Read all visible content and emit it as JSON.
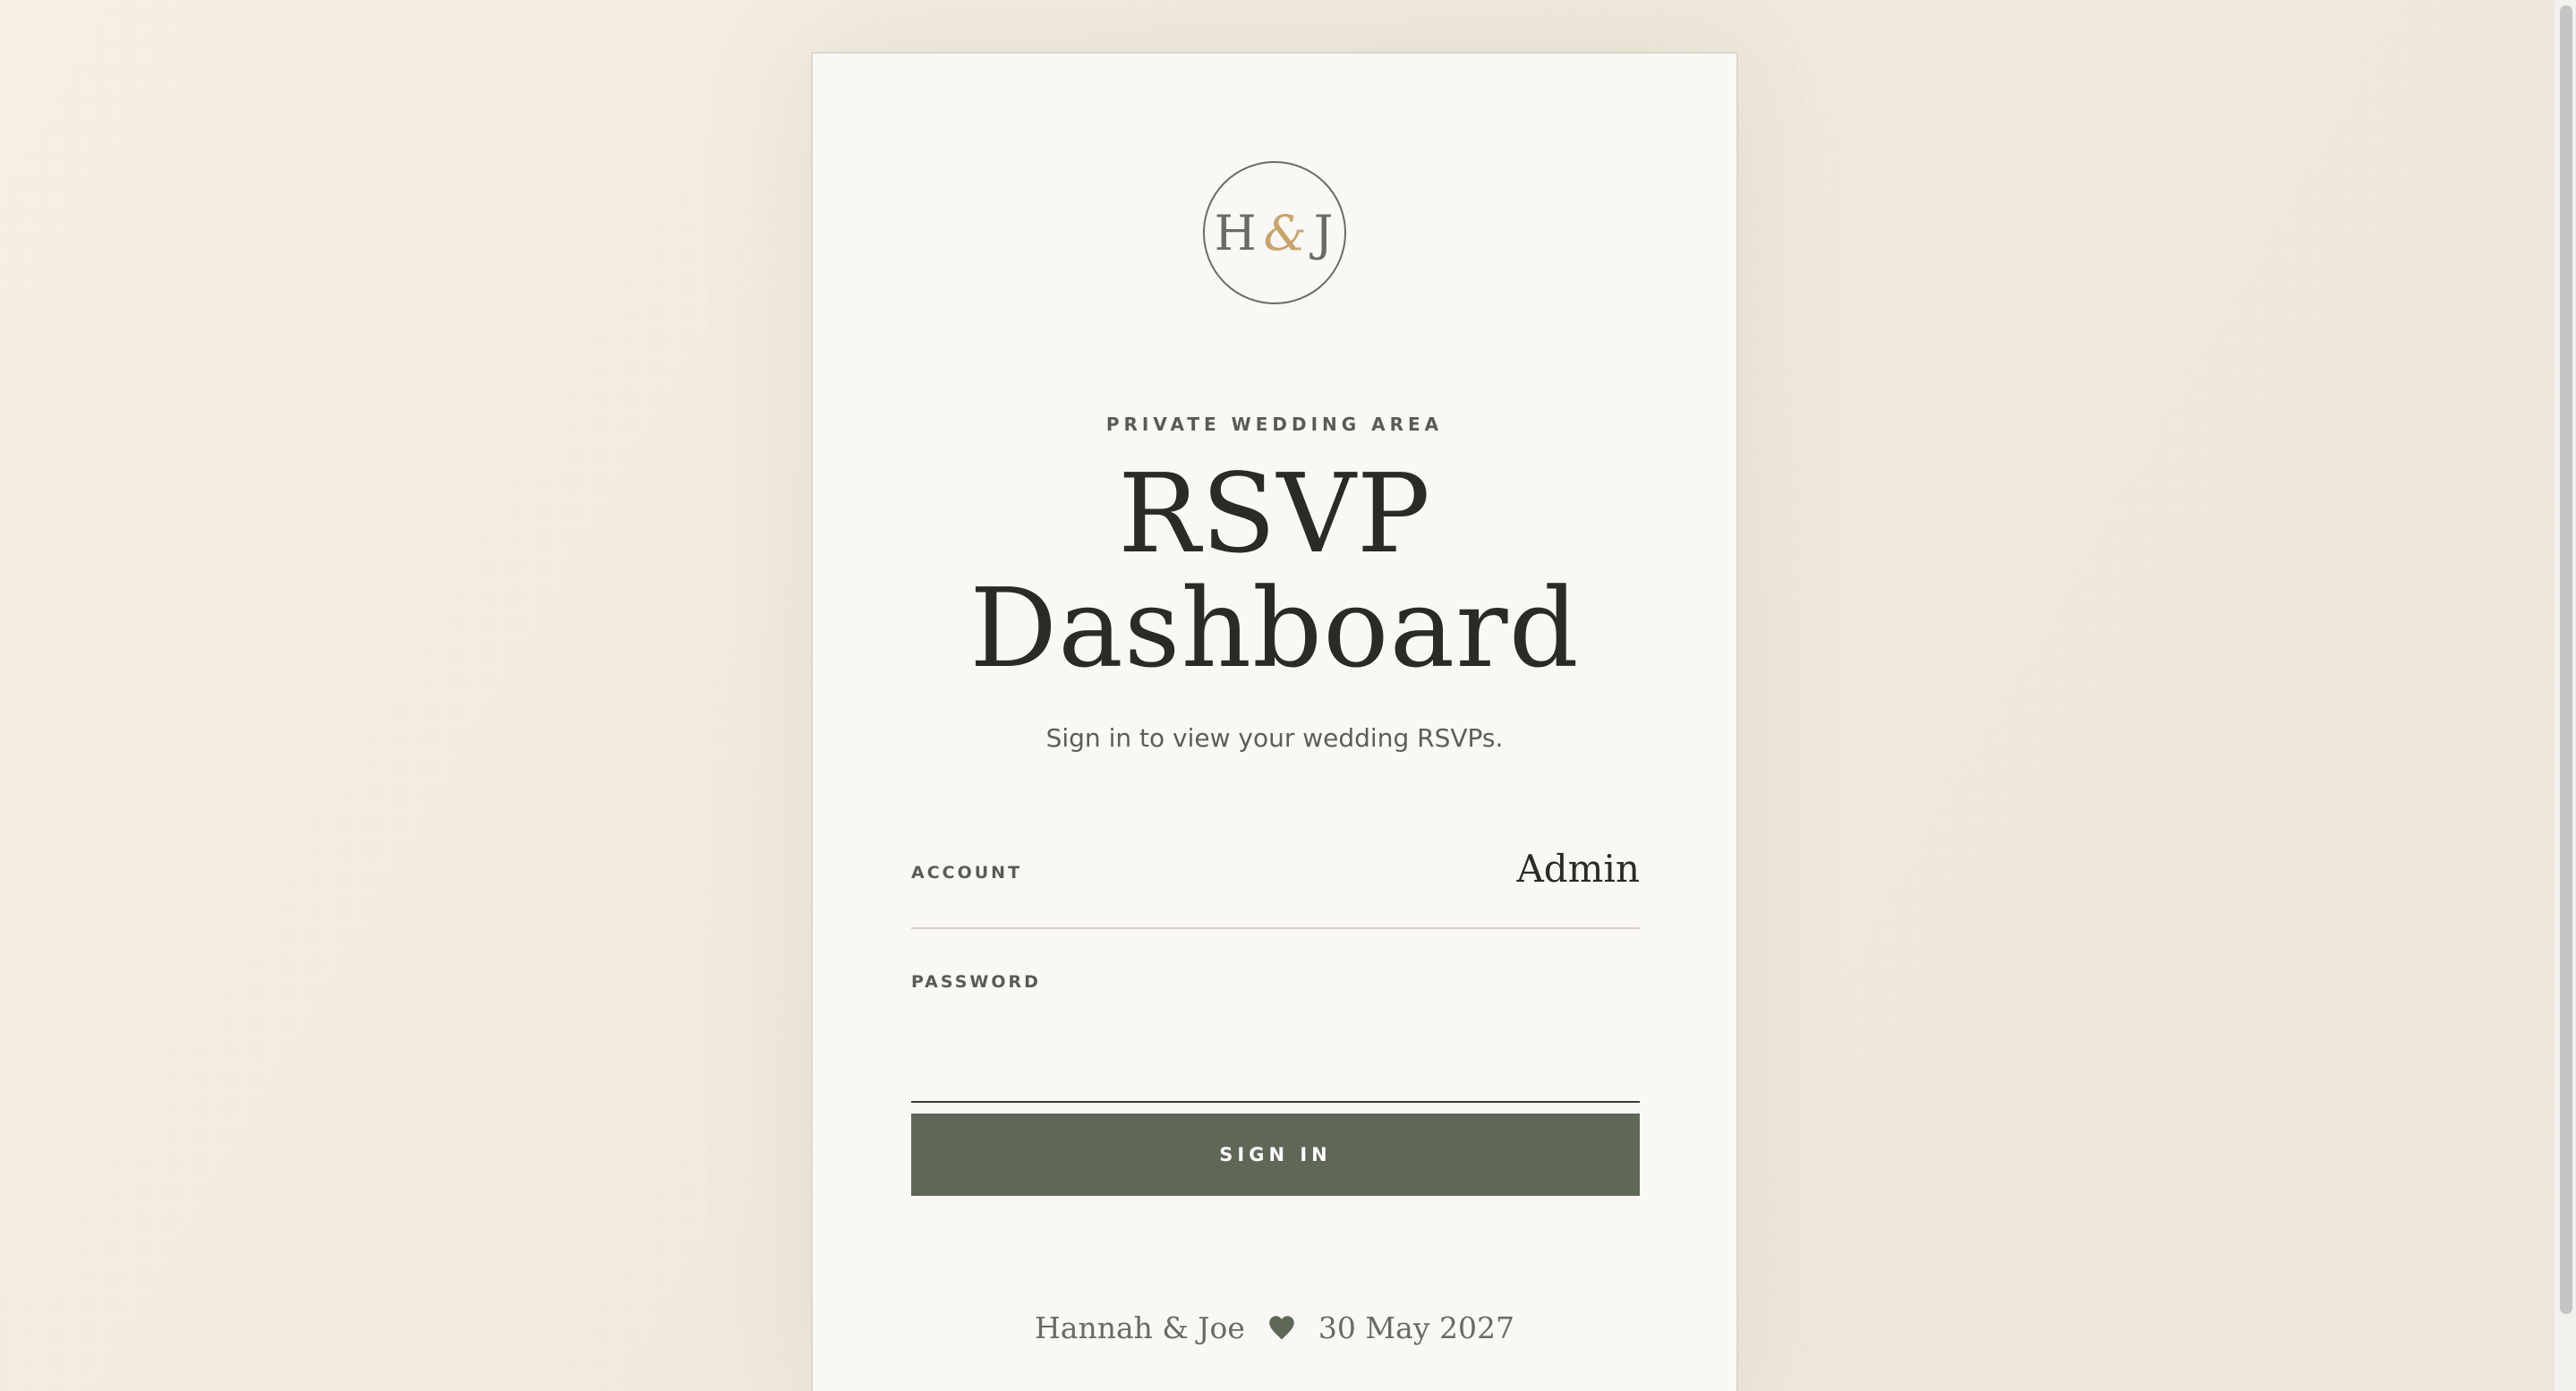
{
  "monogram": {
    "left": "H",
    "amp": "&",
    "right": "J"
  },
  "header": {
    "eyebrow": "PRIVATE WEDDING AREA",
    "title_line1": "RSVP",
    "title_line2": "Dashboard",
    "subtitle": "Sign in to view your wedding RSVPs."
  },
  "form": {
    "account_label": "ACCOUNT",
    "account_value": "Admin",
    "password_label": "PASSWORD",
    "password_value": "",
    "sign_in_label": "SIGN IN"
  },
  "footer": {
    "couple": "Hannah & Joe",
    "icon": "heart-icon",
    "date": "30 May 2027"
  },
  "colors": {
    "accent_gold": "#c9a46a",
    "button": "#5f6757",
    "text_dark": "#2a2a27"
  }
}
